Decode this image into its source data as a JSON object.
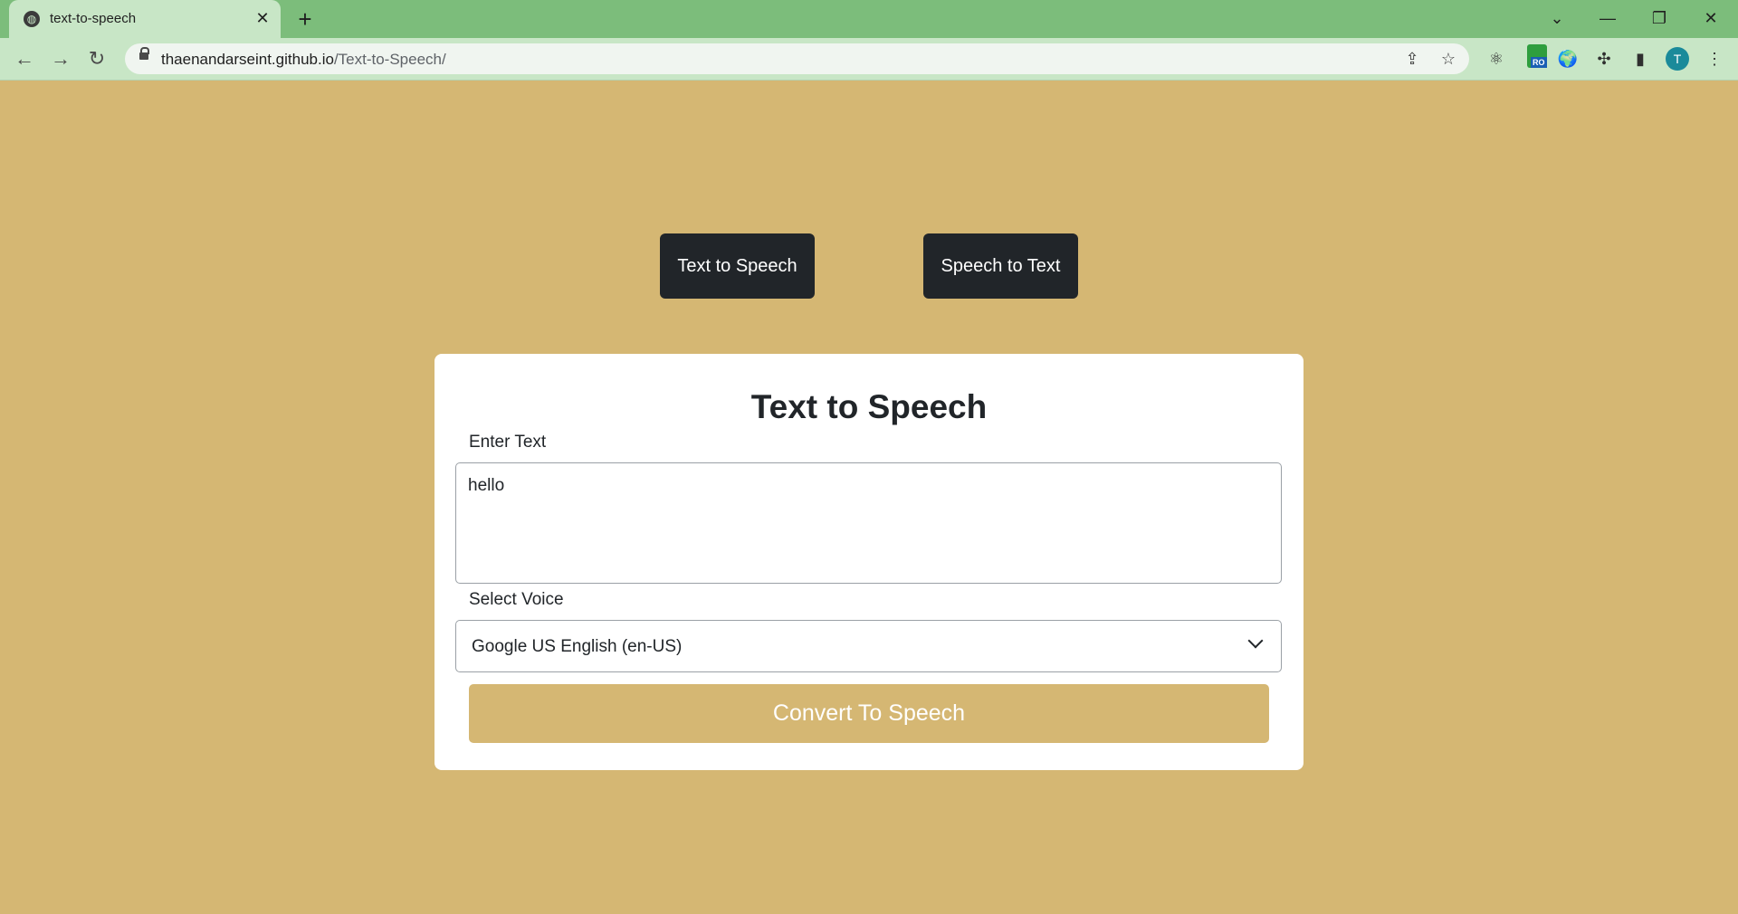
{
  "browser": {
    "tab_title": "text-to-speech",
    "tab_favicon": "globe-icon",
    "tab_close": "✕",
    "new_tab": "+",
    "url_host": "thaenandarseint.github.io",
    "url_path": "/Text-to-Speech/",
    "profile_initial": "T",
    "extension_badge": "RO",
    "window_controls": {
      "dropdown": "⌄",
      "minimize": "—",
      "restore": "❐",
      "close": "✕"
    },
    "nav": {
      "back": "←",
      "forward": "→",
      "reload": "↻"
    },
    "toolbar_icons": {
      "share": "⇪",
      "bookmark": "☆",
      "menu": "⋮"
    }
  },
  "page": {
    "background_color": "#d5b773",
    "nav_buttons": {
      "text_to_speech": "Text to Speech",
      "speech_to_text": "Speech to Text"
    },
    "card": {
      "title": "Text to Speech",
      "text_label": "Enter Text",
      "text_value": "hello",
      "voice_label": "Select Voice",
      "voice_selected": "Google US English (en-US)",
      "convert_label": "Convert To Speech"
    }
  }
}
